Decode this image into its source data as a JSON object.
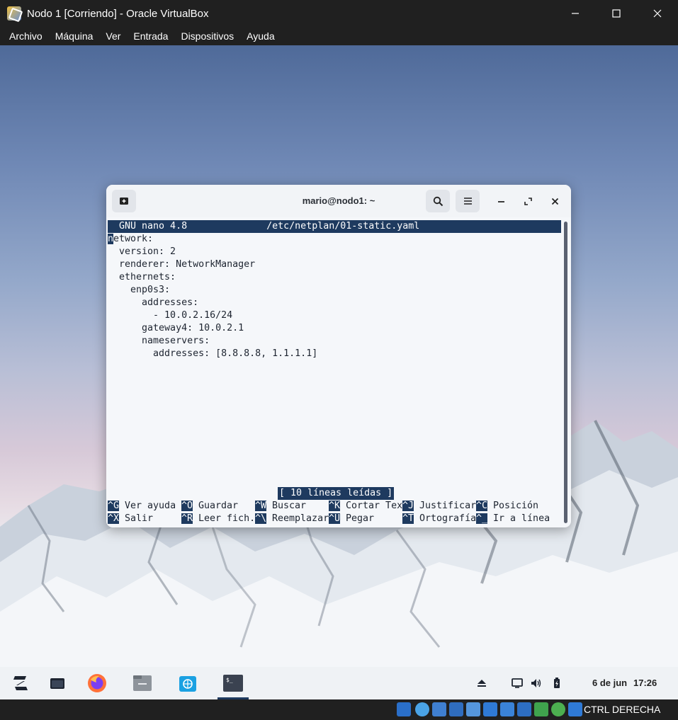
{
  "window": {
    "title": "Nodo 1 [Corriendo] - Oracle VirtualBox"
  },
  "menubar": {
    "items": [
      "Archivo",
      "Máquina",
      "Ver",
      "Entrada",
      "Dispositivos",
      "Ayuda"
    ]
  },
  "terminal": {
    "title": "mario@nodo1: ~",
    "nano_header": "  GNU nano 4.8              /etc/netplan/01-static.yaml",
    "cursor_char": "n",
    "lines": [
      "etwork:",
      "  version: 2",
      "  renderer: NetworkManager",
      "  ethernets:",
      "    enp0s3:",
      "      addresses:",
      "        - 10.0.2.16/24",
      "      gateway4: 10.0.2.1",
      "      nameservers:",
      "        addresses: [8.8.8.8, 1.1.1.1]"
    ],
    "status": "[ 10 líneas leídas ]",
    "shortcuts_row1": [
      {
        "key": "^G",
        "label": " Ver ayuda"
      },
      {
        "key": "^O",
        "label": " Guardar"
      },
      {
        "key": "^W",
        "label": " Buscar"
      },
      {
        "key": "^K",
        "label": " Cortar Tex"
      },
      {
        "key": "^J",
        "label": " Justificar"
      },
      {
        "key": "^C",
        "label": " Posición"
      }
    ],
    "shortcuts_row2": [
      {
        "key": "^X",
        "label": " Salir"
      },
      {
        "key": "^R",
        "label": " Leer fich."
      },
      {
        "key": "^\\",
        "label": " Reemplazar"
      },
      {
        "key": "^U",
        "label": " Pegar"
      },
      {
        "key": "^T",
        "label": " Ortografía"
      },
      {
        "key": "^_",
        "label": " Ir a línea"
      }
    ]
  },
  "taskbar": {
    "clock_date": "6 de jun",
    "clock_time": "17:26",
    "apps": [
      "zorin-menu-icon",
      "files-window-icon",
      "firefox-icon",
      "file-manager-icon",
      "software-store-icon",
      "terminal-icon"
    ]
  },
  "statusbar": {
    "host_key": "CTRL DERECHA"
  },
  "colors": {
    "nano_bar": "#1e3a5f",
    "host_chrome": "#202020"
  }
}
